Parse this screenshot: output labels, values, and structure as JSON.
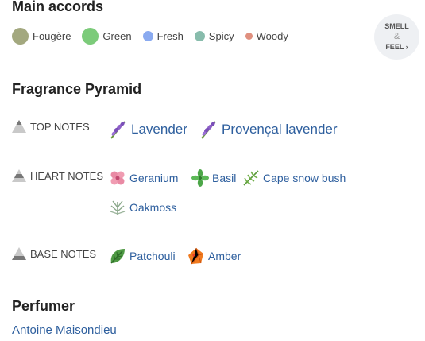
{
  "accords": {
    "title": "Main accords",
    "items": [
      {
        "label": "Fougère",
        "color": "#a3a87f",
        "size": 21
      },
      {
        "label": "Green",
        "color": "#7ccb7a",
        "size": 21
      },
      {
        "label": "Fresh",
        "color": "#8aaaf0",
        "size": 13
      },
      {
        "label": "Spicy",
        "color": "#88bcac",
        "size": 13
      },
      {
        "label": "Woody",
        "color": "#e0907f",
        "size": 9
      }
    ]
  },
  "smell_feel": {
    "line1": "SMELL",
    "amp": "&",
    "line2": "FEEL",
    "chevron": "›"
  },
  "pyramid": {
    "title": "Fragrance Pyramid",
    "top_label": "TOP NOTES",
    "heart_label": "HEART NOTES",
    "base_label": "BASE NOTES",
    "top": [
      {
        "label": "Lavender",
        "icon": "lavender-icon"
      },
      {
        "label": "Provençal lavender",
        "icon": "provencal-lavender-icon"
      }
    ],
    "heart": [
      {
        "label": "Geranium",
        "icon": "geranium-icon"
      },
      {
        "label": "Basil",
        "icon": "basil-icon"
      },
      {
        "label": "Cape snow bush",
        "icon": "cape-snow-bush-icon"
      },
      {
        "label": "Oakmoss",
        "icon": "oakmoss-icon"
      }
    ],
    "base": [
      {
        "label": "Patchouli",
        "icon": "patchouli-icon"
      },
      {
        "label": "Amber",
        "icon": "amber-icon"
      }
    ]
  },
  "perfumer": {
    "title": "Perfumer",
    "name": "Antoine Maisondieu"
  }
}
